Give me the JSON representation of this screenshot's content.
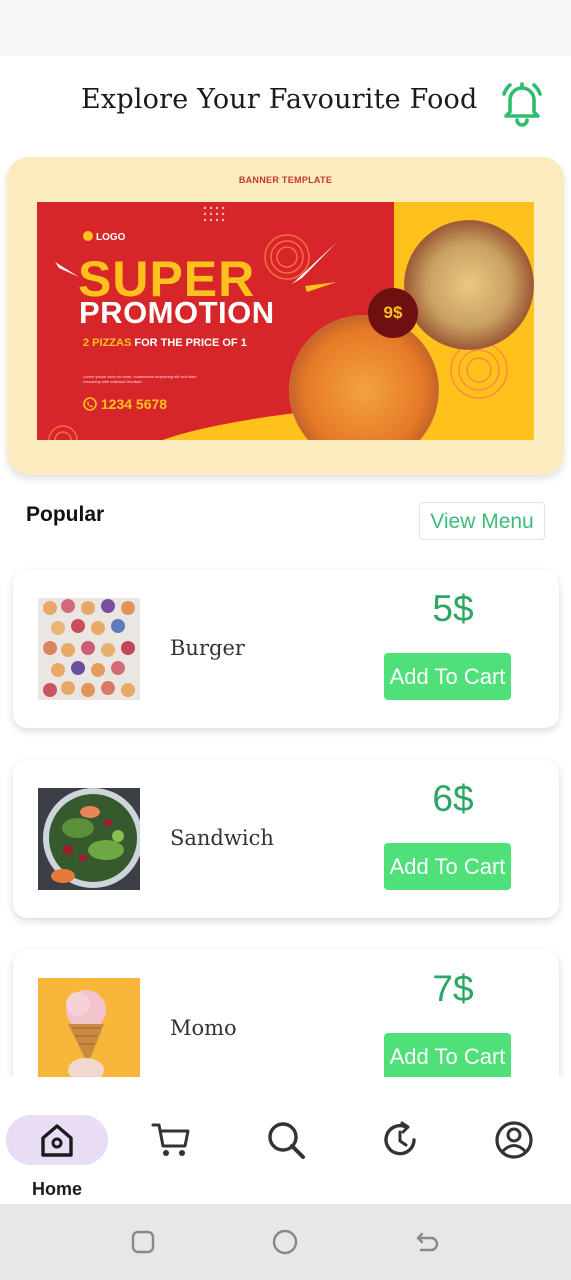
{
  "header": {
    "title": "Explore Your Favourite Food",
    "bell_icon": "bell-icon",
    "accent_color": "#2ebd6f"
  },
  "banner": {
    "label": "BANNER TEMPLATE",
    "logo_text": "LOGO",
    "headline_1": "SUPER",
    "headline_2": "PROMOTION",
    "offer_highlight": "2 PIZZAS",
    "offer_rest": " FOR THE PRICE OF 1",
    "small_text": "Lorem ipsum dolor sit amet, consectetur adipiscing elit sed diam nonummy nibh euismod tincidunt.",
    "phone": "1234 5678",
    "price_badge": "9$"
  },
  "popular": {
    "title": "Popular",
    "view_menu_label": "View Menu"
  },
  "items": [
    {
      "name": "Burger",
      "price": "5$",
      "button": "Add To Cart",
      "image": "donut-platter-image"
    },
    {
      "name": "Sandwich",
      "price": "6$",
      "button": "Add To Cart",
      "image": "salad-bowl-image"
    },
    {
      "name": "Momo",
      "price": "7$",
      "button": "Add To Cart",
      "image": "ice-cream-cone-image"
    }
  ],
  "nav": {
    "home_label": "Home",
    "icons": [
      "home-icon",
      "cart-icon",
      "search-icon",
      "history-icon",
      "profile-icon"
    ],
    "active": "home"
  },
  "colors": {
    "primary_green": "#4fe07a",
    "price_green": "#2aa665",
    "nav_active_bg": "#e9ddf5",
    "banner_bg": "#fdebc0"
  }
}
